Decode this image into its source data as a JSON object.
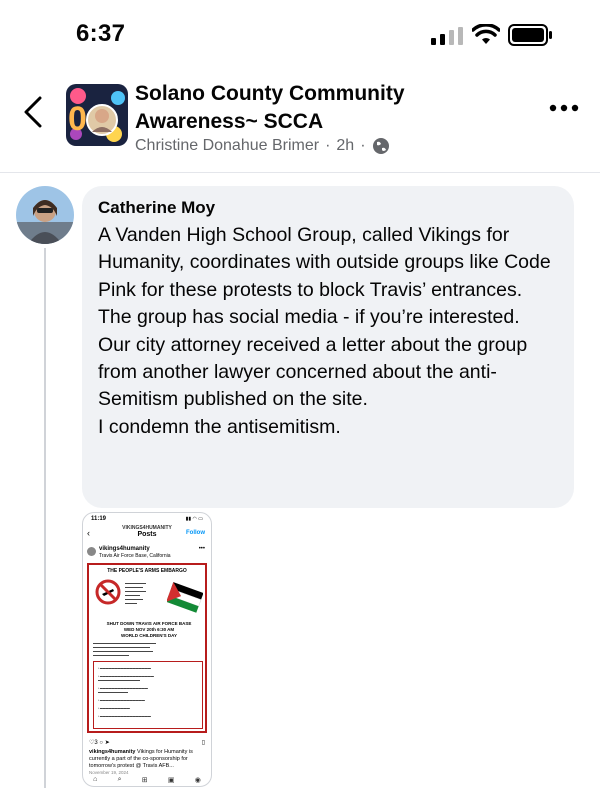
{
  "status_bar": {
    "time": "6:37"
  },
  "header": {
    "group_name": "Solano County Community Awareness~ SCCA",
    "poster": "Christine Donahue Brimer",
    "sep1": "·",
    "age": "2h",
    "sep2": "·",
    "icons": {
      "back": "chevron-left-icon",
      "more": "more-horizontal-icon",
      "audience": "globe-icon"
    }
  },
  "comment": {
    "author": "Catherine Moy",
    "lines": [
      "A Vanden High School Group, called Vikings for Humanity, coordinates with outside groups like Code Pink for these protests to block Travis’ entrances.",
      "The group has social media - if you’re interested.",
      "Our city attorney received a letter about the group from another lawyer concerned about the anti-Semitism published on the site.",
      "I condemn the antisemitism."
    ]
  },
  "attachment": {
    "time": "11:19",
    "account": "VIKINGS4HUMANITY",
    "page": "Posts",
    "follow": "Follow",
    "user": "vikings4humanity",
    "location": "Travis Air Force Base, California",
    "poster_title": "THE PEOPLE'S ARMS EMBARGO",
    "poster_heading": "SHUT DOWN TRAVIS AIR FORCE BASE",
    "poster_date": "WED NOV 20th 6:30 AM",
    "poster_day": "WORLD CHILDREN'S DAY",
    "likes": "3",
    "caption_user": "vikings4humanity",
    "caption": "Vikings for Humanity is currently a part of the co-sponsorship for tomorrow's protest @ Travis AFB...",
    "date": "November 19, 2024"
  },
  "colors": {
    "bubble": "#f0f2f5",
    "meta": "#65676b",
    "poster_border": "#b71c1c"
  }
}
